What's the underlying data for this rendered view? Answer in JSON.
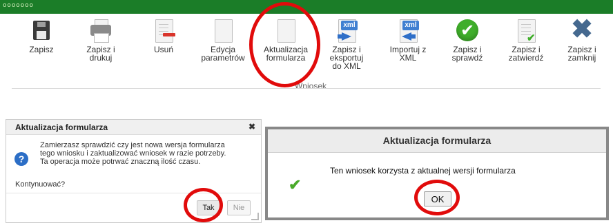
{
  "topbar": {
    "label": "Wniosek"
  },
  "ribbon": {
    "buttons": [
      {
        "label": "Zapisz",
        "icon": "floppy-disk-icon"
      },
      {
        "label": "Zapisz i\ndrukuj",
        "icon": "printer-icon"
      },
      {
        "label": "Usuń",
        "icon": "delete-document-icon"
      },
      {
        "label": "Edycja\nparametrów",
        "icon": "blank-document-icon"
      },
      {
        "label": "Aktualizacja\nformularza",
        "icon": "blank-document-icon"
      },
      {
        "label": "Zapisz i\neksportuj\ndo XML",
        "icon": "xml-export-icon"
      },
      {
        "label": "Importuj z\nXML",
        "icon": "xml-import-icon"
      },
      {
        "label": "Zapisz i\nsprawdź",
        "icon": "green-check-icon"
      },
      {
        "label": "Zapisz i\nzatwierdź",
        "icon": "document-approve-icon"
      },
      {
        "label": "Zapisz i\nzamknij",
        "icon": "close-x-icon"
      }
    ],
    "group_label": "Wniosek"
  },
  "dialog_confirm": {
    "title": "Aktualizacja formularza",
    "message": "Zamierzasz sprawdzić czy jest nowa wersja formularza\ntego wniosku i zaktualizować wniosek w razie potrzeby.\nTa operacja może potrwać znaczną ilość czasu.",
    "question": "Kontynuować?",
    "yes_label": "Tak",
    "no_label": "Nie"
  },
  "dialog_result": {
    "title": "Aktualizacja formularza",
    "message": "Ten wniosek korzysta z aktualnej wersji formularza",
    "ok_label": "OK"
  },
  "colors": {
    "topbar": "#1b7d28",
    "annotation": "#e10b0b",
    "check": "#3fae2a"
  }
}
